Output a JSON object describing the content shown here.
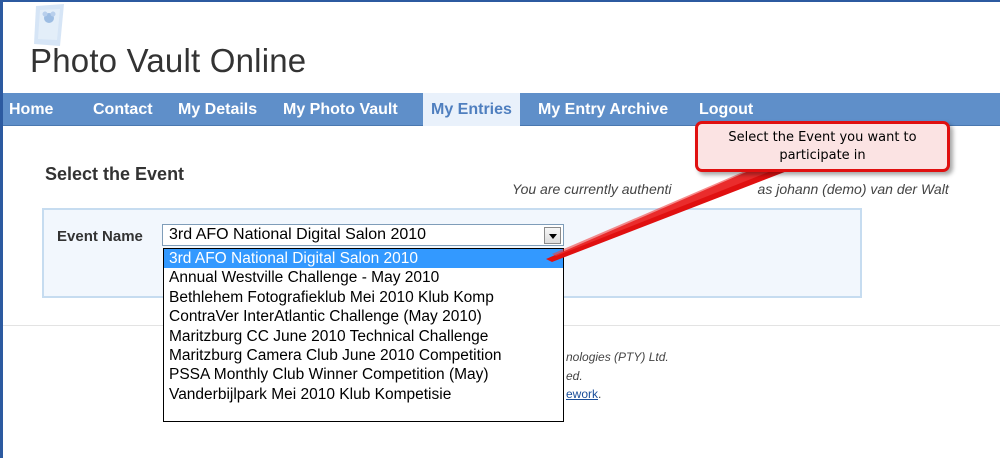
{
  "site": {
    "title": "Photo Vault Online",
    "logo_icon": "photo-vault-logo-icon"
  },
  "nav": {
    "items": [
      {
        "label": "Home",
        "active": false
      },
      {
        "label": "Contact",
        "active": false
      },
      {
        "label": "My Details",
        "active": false
      },
      {
        "label": "My Photo Vault",
        "active": false
      },
      {
        "label": "My Entries",
        "active": true
      },
      {
        "label": "My Entry Archive",
        "active": false
      },
      {
        "label": "Logout",
        "active": false
      }
    ],
    "bar_color": "#5f8fc9",
    "active_color": "#4f7fbf"
  },
  "main": {
    "heading": "Select the Event",
    "auth_prefix": "You are currently authenti",
    "auth_suffix": "as johann (demo) van der Walt",
    "event_label": "Event Name",
    "selected_event": "3rd AFO National Digital Salon 2010",
    "dropdown_icon": "chevron-down-icon",
    "event_options": [
      "3rd AFO National Digital Salon 2010",
      "Annual Westville Challenge - May 2010",
      "Bethlehem Fotografieklub Mei 2010 Klub Komp",
      "ContraVer InterAtlantic Challenge (May 2010)",
      "Maritzburg CC June 2010 Technical Challenge",
      "Maritzburg Camera Club June 2010 Competition",
      "PSSA Monthly Club Winner Competition (May)",
      "Vanderbijlpark Mei 2010 Klub Kompetisie"
    ],
    "highlight_color": "#3399ff"
  },
  "footer": {
    "line1": "nologies (PTY) Ltd.",
    "line2": "ed.",
    "link": "ework",
    "link_suffix": "."
  },
  "callout": {
    "text": "Select the Event you want to participate in",
    "border_color": "#e01010",
    "fill_color": "#fbe3e3"
  }
}
